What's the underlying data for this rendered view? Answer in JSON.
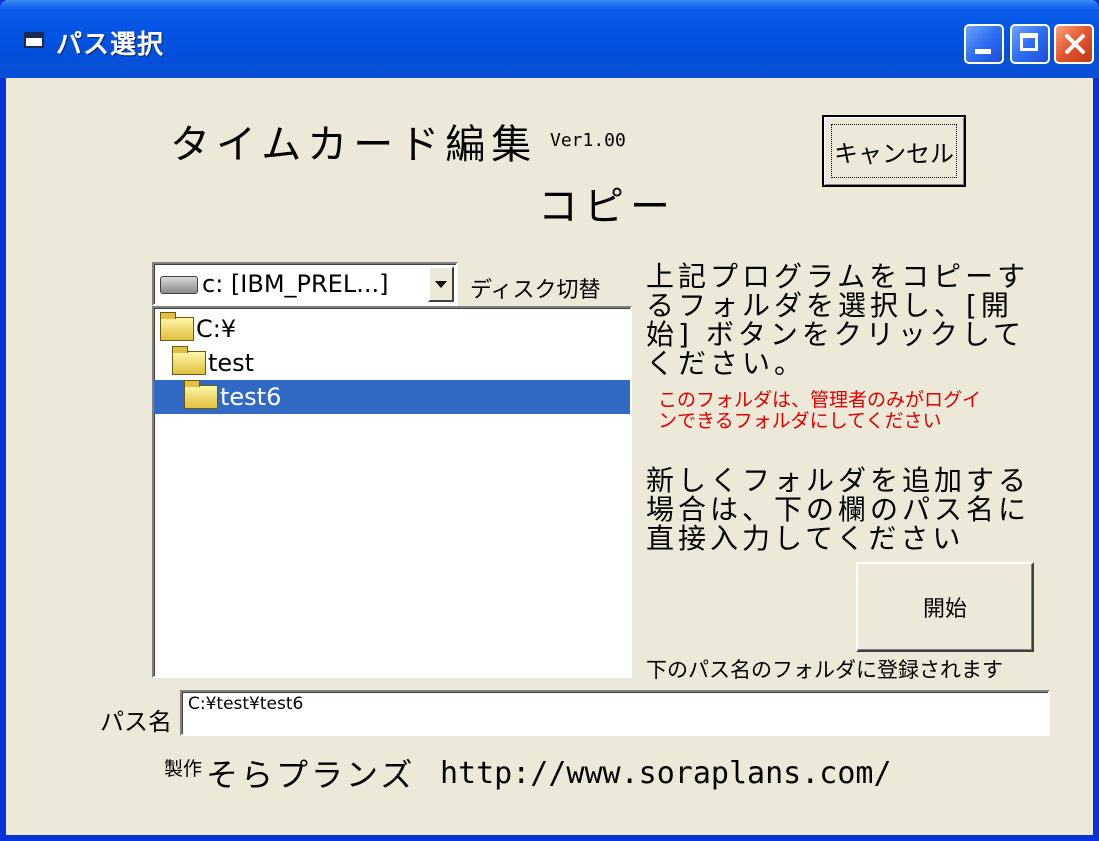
{
  "window": {
    "title": "パス選択"
  },
  "header": {
    "app_title": "タイムカード編集",
    "version": "Ver1.00",
    "mode": "コピー"
  },
  "buttons": {
    "cancel": "キャンセル",
    "start": "開始"
  },
  "drive": {
    "selected": "c: [IBM_PREL...]",
    "switch_label": "ディスク切替"
  },
  "folders": [
    {
      "name": "C:¥",
      "selected": false
    },
    {
      "name": "test",
      "selected": false
    },
    {
      "name": "test6",
      "selected": true
    }
  ],
  "instructions": {
    "copy": "上記プログラムをコピーするフォルダを選択し、[開始] ボタンをクリックしてください。",
    "admin_note": "このフォルダは、管理者のみがログインできるフォルダにしてください",
    "add_folder": "新しくフォルダを追加する場合は、下の欄のパス名に直接入力してください",
    "register_note": "下のパス名のフォルダに登録されます"
  },
  "path": {
    "label": "パス名",
    "value": "C:¥test¥test6"
  },
  "footer": {
    "maker_label": "製作",
    "maker_name": "そらプランズ",
    "url": "http://www.soraplans.com/"
  },
  "colors": {
    "titlebar": "#0553e3",
    "selection": "#316ac5",
    "note_red": "#e00000",
    "face": "#ece9d8"
  }
}
